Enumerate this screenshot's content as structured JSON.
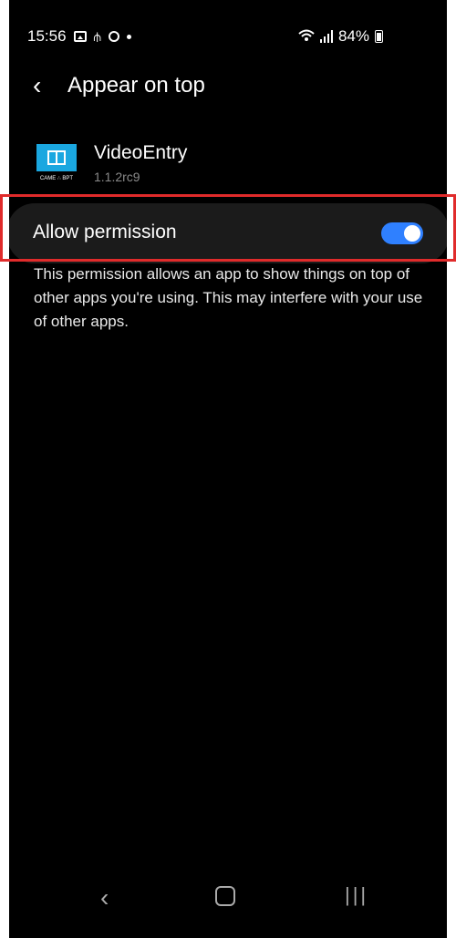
{
  "status_bar": {
    "time": "15:56",
    "battery_percent": "84%",
    "icons": [
      "image-icon",
      "usb-icon",
      "circle-icon",
      "dot-icon",
      "wifi-icon",
      "signal-icon",
      "battery-icon"
    ]
  },
  "header": {
    "back_icon": "back-icon",
    "back_glyph": "‹",
    "title": "Appear on top"
  },
  "app": {
    "name": "VideoEntry",
    "version": "1.1.2rc9",
    "icon_label": "CAME ∴ BPT",
    "icon_colors": {
      "top": "#1aa7e0",
      "bottom": "#000000"
    }
  },
  "permission": {
    "label": "Allow permission",
    "toggle_on": true,
    "toggle_color": "#2f80ff"
  },
  "description": "This permission allows an app to show things on top of other apps you're using. This may interfere with your use of other apps.",
  "nav_bar": {
    "back_glyph": "‹",
    "recent_glyph": "|||"
  }
}
